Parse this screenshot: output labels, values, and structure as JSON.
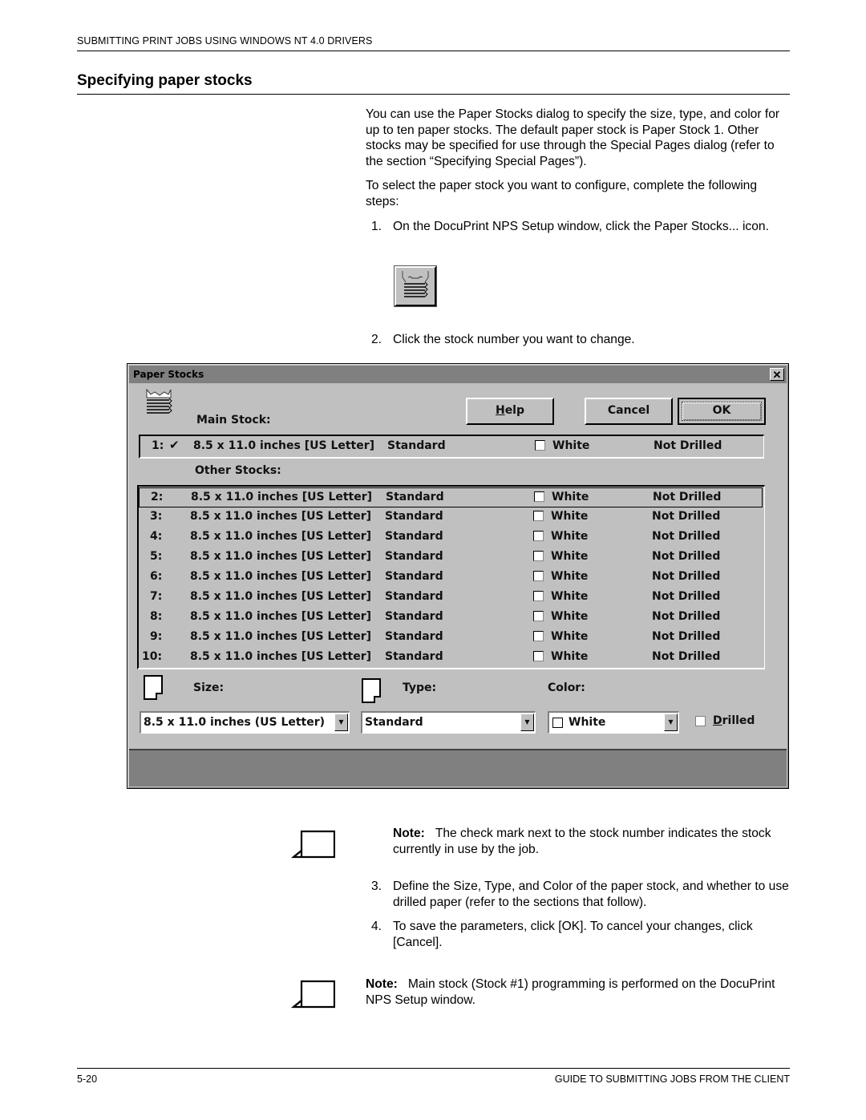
{
  "header": {
    "running_head": "SUBMITTING PRINT JOBS USING WINDOWS NT 4.0 DRIVERS",
    "section_title": "Specifying paper stocks"
  },
  "body": {
    "para1": "You can use the Paper Stocks dialog to specify the size, type, and color for up to ten paper stocks. The default paper stock is Paper Stock 1.  Other stocks may be specified for use through the Special Pages dialog (refer to the section “Specifying Special Pages”).",
    "para2": "To select the paper stock you want to configure, complete the following steps:",
    "steps": [
      {
        "num": "1.",
        "text": "On the DocuPrint NPS Setup window, click the Paper Stocks... icon."
      },
      {
        "num": "2.",
        "text": "Click the stock number you want to change."
      },
      {
        "num": "3.",
        "text": "Define the Size, Type, and Color of the paper stock, and whether to use drilled paper (refer to the sections that follow)."
      },
      {
        "num": "4.",
        "text": "To save the parameters, click [OK]. To cancel your changes, click [Cancel]."
      }
    ],
    "notes": [
      {
        "label": "Note:",
        "text": "The check mark next to the stock number indicates the stock currently in use by the job."
      },
      {
        "label": "Note:",
        "text": "Main stock (Stock #1) programming is performed on the DocuPrint NPS Setup window."
      }
    ]
  },
  "icons": {
    "paper_stocks_button": "paper-stack-icon",
    "note": "note-page-icon"
  },
  "dialog": {
    "title": "Paper Stocks",
    "close_glyph": "✕",
    "buttons": {
      "help_prefix": "H",
      "help_rest": "elp",
      "cancel": "Cancel",
      "ok": "OK"
    },
    "main_stock_label": "Main Stock:",
    "other_stocks_label": "Other Stocks:",
    "main_stock": {
      "num": "1:",
      "current_marker": "✔",
      "size": "8.5 x 11.0 inches [US Letter]",
      "type": "Standard",
      "color": "White",
      "drilled": "Not Drilled"
    },
    "other_stocks": [
      {
        "num": "2:",
        "size": "8.5 x 11.0 inches [US Letter]",
        "type": "Standard",
        "color": "White",
        "drilled": "Not Drilled",
        "selected": true
      },
      {
        "num": "3:",
        "size": "8.5 x 11.0 inches [US Letter]",
        "type": "Standard",
        "color": "White",
        "drilled": "Not Drilled"
      },
      {
        "num": "4:",
        "size": "8.5 x 11.0 inches [US Letter]",
        "type": "Standard",
        "color": "White",
        "drilled": "Not Drilled"
      },
      {
        "num": "5:",
        "size": "8.5 x 11.0 inches [US Letter]",
        "type": "Standard",
        "color": "White",
        "drilled": "Not Drilled"
      },
      {
        "num": "6:",
        "size": "8.5 x 11.0 inches [US Letter]",
        "type": "Standard",
        "color": "White",
        "drilled": "Not Drilled"
      },
      {
        "num": "7:",
        "size": "8.5 x 11.0 inches [US Letter]",
        "type": "Standard",
        "color": "White",
        "drilled": "Not Drilled"
      },
      {
        "num": "8:",
        "size": "8.5 x 11.0 inches [US Letter]",
        "type": "Standard",
        "color": "White",
        "drilled": "Not Drilled"
      },
      {
        "num": "9:",
        "size": "8.5 x 11.0 inches [US Letter]",
        "type": "Standard",
        "color": "White",
        "drilled": "Not Drilled"
      },
      {
        "num": "10:",
        "size": "8.5 x 11.0 inches [US Letter]",
        "type": "Standard",
        "color": "White",
        "drilled": "Not Drilled"
      }
    ],
    "size_label": "Size:",
    "type_label": "Type:",
    "color_label": "Color:",
    "size_value": "8.5 x 11.0 inches (US Letter)",
    "type_value": "Standard",
    "color_value": "White",
    "drilled_prefix": "D",
    "drilled_rest": "rilled",
    "drilled_checked": false,
    "dropdown_arrow": "▼"
  },
  "footer": {
    "page_number": "5-20",
    "guide_title": "GUIDE TO SUBMITTING JOBS FROM THE CLIENT"
  }
}
